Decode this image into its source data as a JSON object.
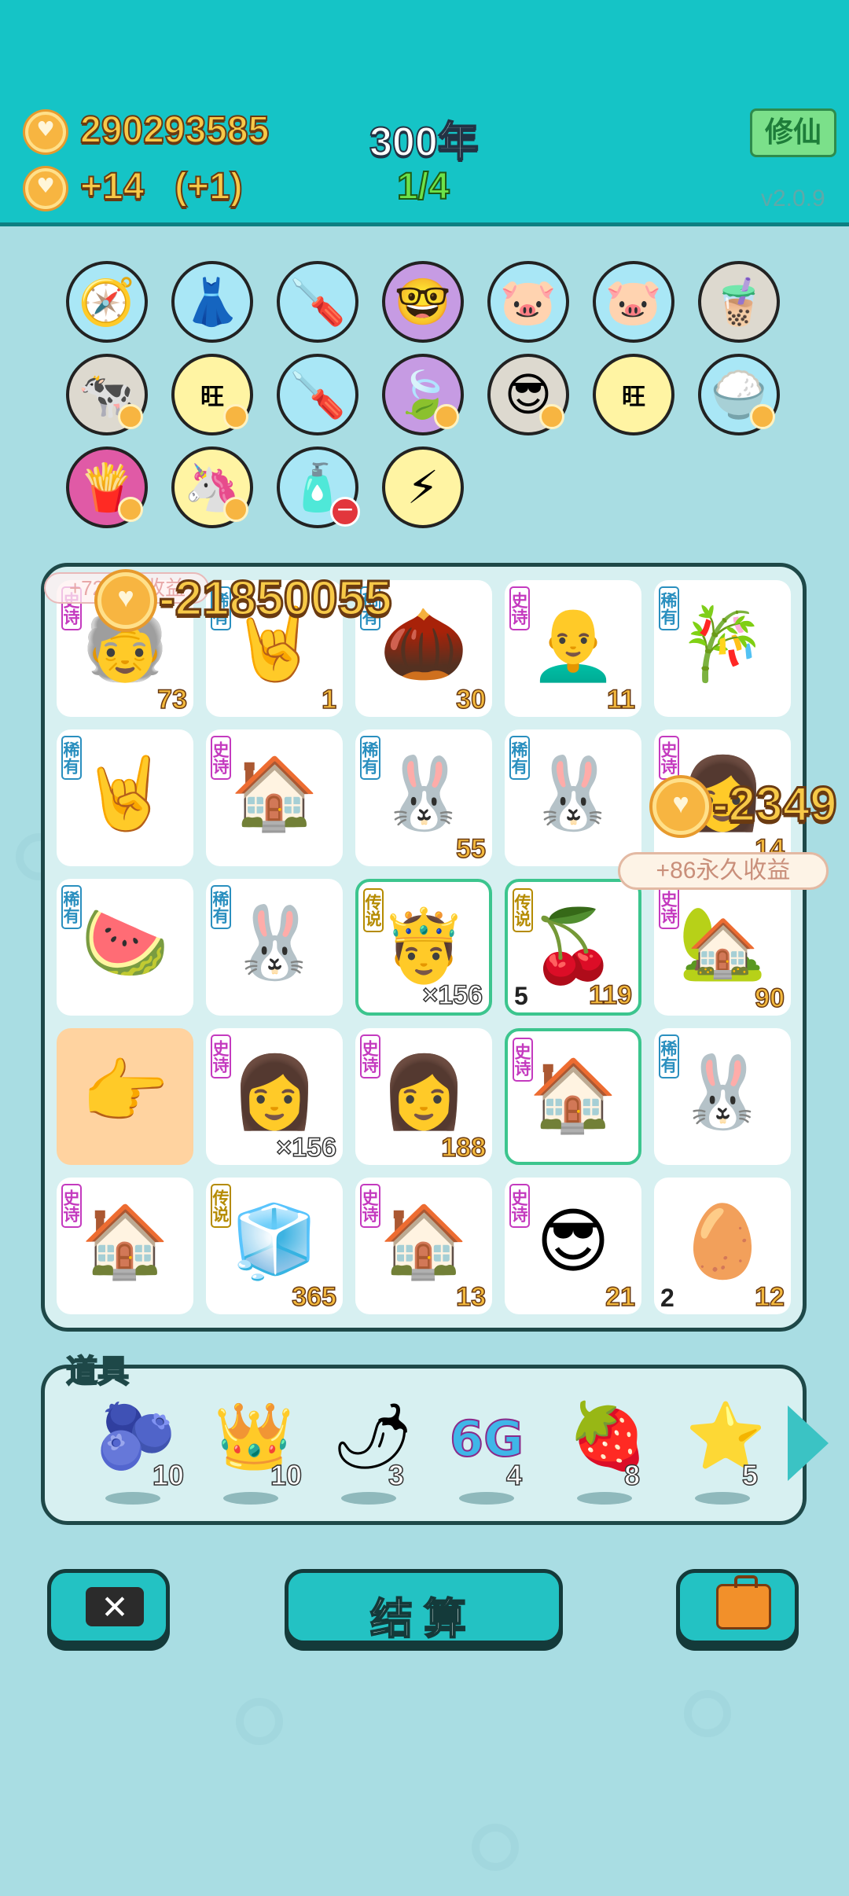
{
  "header": {
    "coins": "290293585",
    "income": "+14",
    "income_bonus": "(+1)",
    "year": "300年",
    "progress": "1/4",
    "cultivate_button": "修仙",
    "version": "v2.0.9"
  },
  "relics": [
    {
      "icon": "compass-icon",
      "glyph": "🧭",
      "bg": "blue"
    },
    {
      "icon": "skirt-icon",
      "glyph": "👗",
      "bg": "blue"
    },
    {
      "icon": "air-pump-icon",
      "glyph": "🪛",
      "bg": "blue"
    },
    {
      "icon": "math-nerd-icon",
      "glyph": "🤓",
      "bg": "purple"
    },
    {
      "icon": "piggy-bank-icon",
      "glyph": "🐷",
      "bg": "blue"
    },
    {
      "icon": "piggy-bank-icon",
      "glyph": "🐷",
      "bg": "blue"
    },
    {
      "icon": "bubble-tea-icon",
      "glyph": "🧋",
      "bg": "grey"
    },
    {
      "icon": "cows-icon",
      "glyph": "🐄",
      "bg": "grey"
    },
    {
      "icon": "wang-wang-icon",
      "glyph": "旺",
      "bg": "yellow"
    },
    {
      "icon": "air-pump-icon",
      "glyph": "🪛",
      "bg": "blue"
    },
    {
      "icon": "leaf-icon",
      "glyph": "🍃",
      "bg": "purple"
    },
    {
      "icon": "sunglasses-cat-icon",
      "glyph": "😎",
      "bg": "grey"
    },
    {
      "icon": "wang-wang-icon",
      "glyph": "旺",
      "bg": "yellow"
    },
    {
      "icon": "rice-bowl-icon",
      "glyph": "🍚",
      "bg": "blue"
    },
    {
      "icon": "french-fries-icon",
      "glyph": "🍟",
      "bg": "red"
    },
    {
      "icon": "unicorn-icon",
      "glyph": "🦄",
      "bg": "yellow"
    },
    {
      "icon": "gas-canister-icon",
      "glyph": "🧴",
      "bg": "blue"
    },
    {
      "icon": "lightning-icon",
      "glyph": "⚡",
      "bg": "yellow"
    }
  ],
  "board": [
    {
      "icon": "old-man-icon",
      "glyph": "🧓",
      "tag": "史诗",
      "tag_class": "epic",
      "count": "73"
    },
    {
      "icon": "rock-hand-icon",
      "glyph": "🤘",
      "tag": "稀有",
      "tag_class": "rare",
      "count": "1"
    },
    {
      "icon": "hazelnut-icon",
      "glyph": "🌰",
      "tag": "稀有",
      "tag_class": "rare",
      "count": "30"
    },
    {
      "icon": "bald-man-icon",
      "glyph": "👨‍🦲",
      "tag": "史诗",
      "tag_class": "epic",
      "count": "11"
    },
    {
      "icon": "bamboo-icon",
      "glyph": "🎋",
      "tag": "稀有",
      "tag_class": "rare",
      "count": ""
    },
    {
      "icon": "rock-hand-icon",
      "glyph": "🤘",
      "tag": "稀有",
      "tag_class": "rare",
      "count": ""
    },
    {
      "icon": "rabbit-king-house-icon",
      "glyph": "🏠",
      "tag": "史诗",
      "tag_class": "epic",
      "count": ""
    },
    {
      "icon": "rabbit-icon",
      "glyph": "🐰",
      "tag": "稀有",
      "tag_class": "rare",
      "count": "55"
    },
    {
      "icon": "rabbit-icon",
      "glyph": "🐰",
      "tag": "稀有",
      "tag_class": "rare",
      "count": ""
    },
    {
      "icon": "girl-icon",
      "glyph": "👩",
      "tag": "史诗",
      "tag_class": "epic",
      "count": "14"
    },
    {
      "icon": "watermelon-icon",
      "glyph": "🍉",
      "tag": "稀有",
      "tag_class": "rare",
      "count": ""
    },
    {
      "icon": "rabbit-lantern-icon",
      "glyph": "🐰",
      "tag": "稀有",
      "tag_class": "rare",
      "count": ""
    },
    {
      "icon": "king-icon",
      "glyph": "🤴",
      "tag": "传说",
      "tag_class": "legend",
      "count": "×156",
      "hl": true
    },
    {
      "icon": "longan-icon",
      "glyph": "🍒",
      "tag": "传说",
      "tag_class": "legend",
      "count": "119",
      "left": "5",
      "hl": true
    },
    {
      "icon": "lucky-house-icon",
      "glyph": "🏡",
      "tag": "史诗",
      "tag_class": "epic",
      "count": "90"
    },
    {
      "icon": "pointing-hand-icon",
      "glyph": "👉",
      "tag": "",
      "tag_class": "",
      "count": "",
      "orange": true
    },
    {
      "icon": "girl-icon",
      "glyph": "👩",
      "tag": "史诗",
      "tag_class": "epic",
      "count": "×156"
    },
    {
      "icon": "girl-icon",
      "glyph": "👩",
      "tag": "史诗",
      "tag_class": "epic",
      "count": "188"
    },
    {
      "icon": "rabbit-king-house-icon",
      "glyph": "🏠",
      "tag": "史诗",
      "tag_class": "epic",
      "count": "",
      "hl": true
    },
    {
      "icon": "rabbit-icon",
      "glyph": "🐰",
      "tag": "稀有",
      "tag_class": "rare",
      "count": ""
    },
    {
      "icon": "rabbit-house-icon",
      "glyph": "🏠",
      "tag": "史诗",
      "tag_class": "epic",
      "count": ""
    },
    {
      "icon": "fridge-icon",
      "glyph": "🧊",
      "tag": "传说",
      "tag_class": "legend",
      "count": "365"
    },
    {
      "icon": "rabbit-house-icon",
      "glyph": "🏠",
      "tag": "史诗",
      "tag_class": "epic",
      "count": "13"
    },
    {
      "icon": "cool-guy-icon",
      "glyph": "😎",
      "tag": "史诗",
      "tag_class": "epic",
      "count": "21"
    },
    {
      "icon": "egg-icon",
      "glyph": "🥚",
      "tag": "",
      "tag_class": "",
      "count": "12",
      "left": "2"
    }
  ],
  "floaters": {
    "loss_top": "-21850055",
    "loss_right": "-2349",
    "ghost_tip": "+72永久收益",
    "tooltip": "+86永久收益"
  },
  "tools": {
    "title": "道具",
    "items": [
      {
        "icon": "blueberry-icon",
        "glyph": "🫐",
        "count": "10"
      },
      {
        "icon": "crown-icon",
        "glyph": "👑",
        "count": "10"
      },
      {
        "icon": "chili-icon",
        "glyph": "🌶",
        "count": "3"
      },
      {
        "icon": "6g-icon",
        "glyph": "6G",
        "count": "4"
      },
      {
        "icon": "lychee-icon",
        "glyph": "🍓",
        "count": "8"
      },
      {
        "icon": "star-icon",
        "glyph": "⭐",
        "count": "5"
      }
    ]
  },
  "buttons": {
    "settle": "结算"
  }
}
